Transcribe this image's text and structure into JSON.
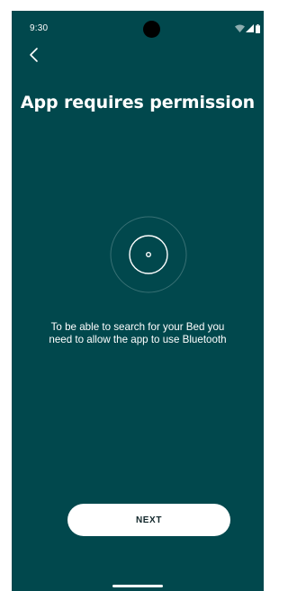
{
  "status_bar": {
    "time": "9:30",
    "icons": [
      "wifi-icon",
      "cellular-signal-icon",
      "battery-icon"
    ]
  },
  "navigation": {
    "back_icon": "chevron-left-icon"
  },
  "main": {
    "title": "App requires permission",
    "illustration_icon": "bluetooth-scan-icon",
    "description": "To be able to search for your Bed you need to allow the app to use Bluetooth"
  },
  "actions": {
    "next_label": "NEXT"
  },
  "colors": {
    "background": "#01484d",
    "text": "#ffffff",
    "button_background": "#ffffff",
    "button_text": "#11262a"
  }
}
